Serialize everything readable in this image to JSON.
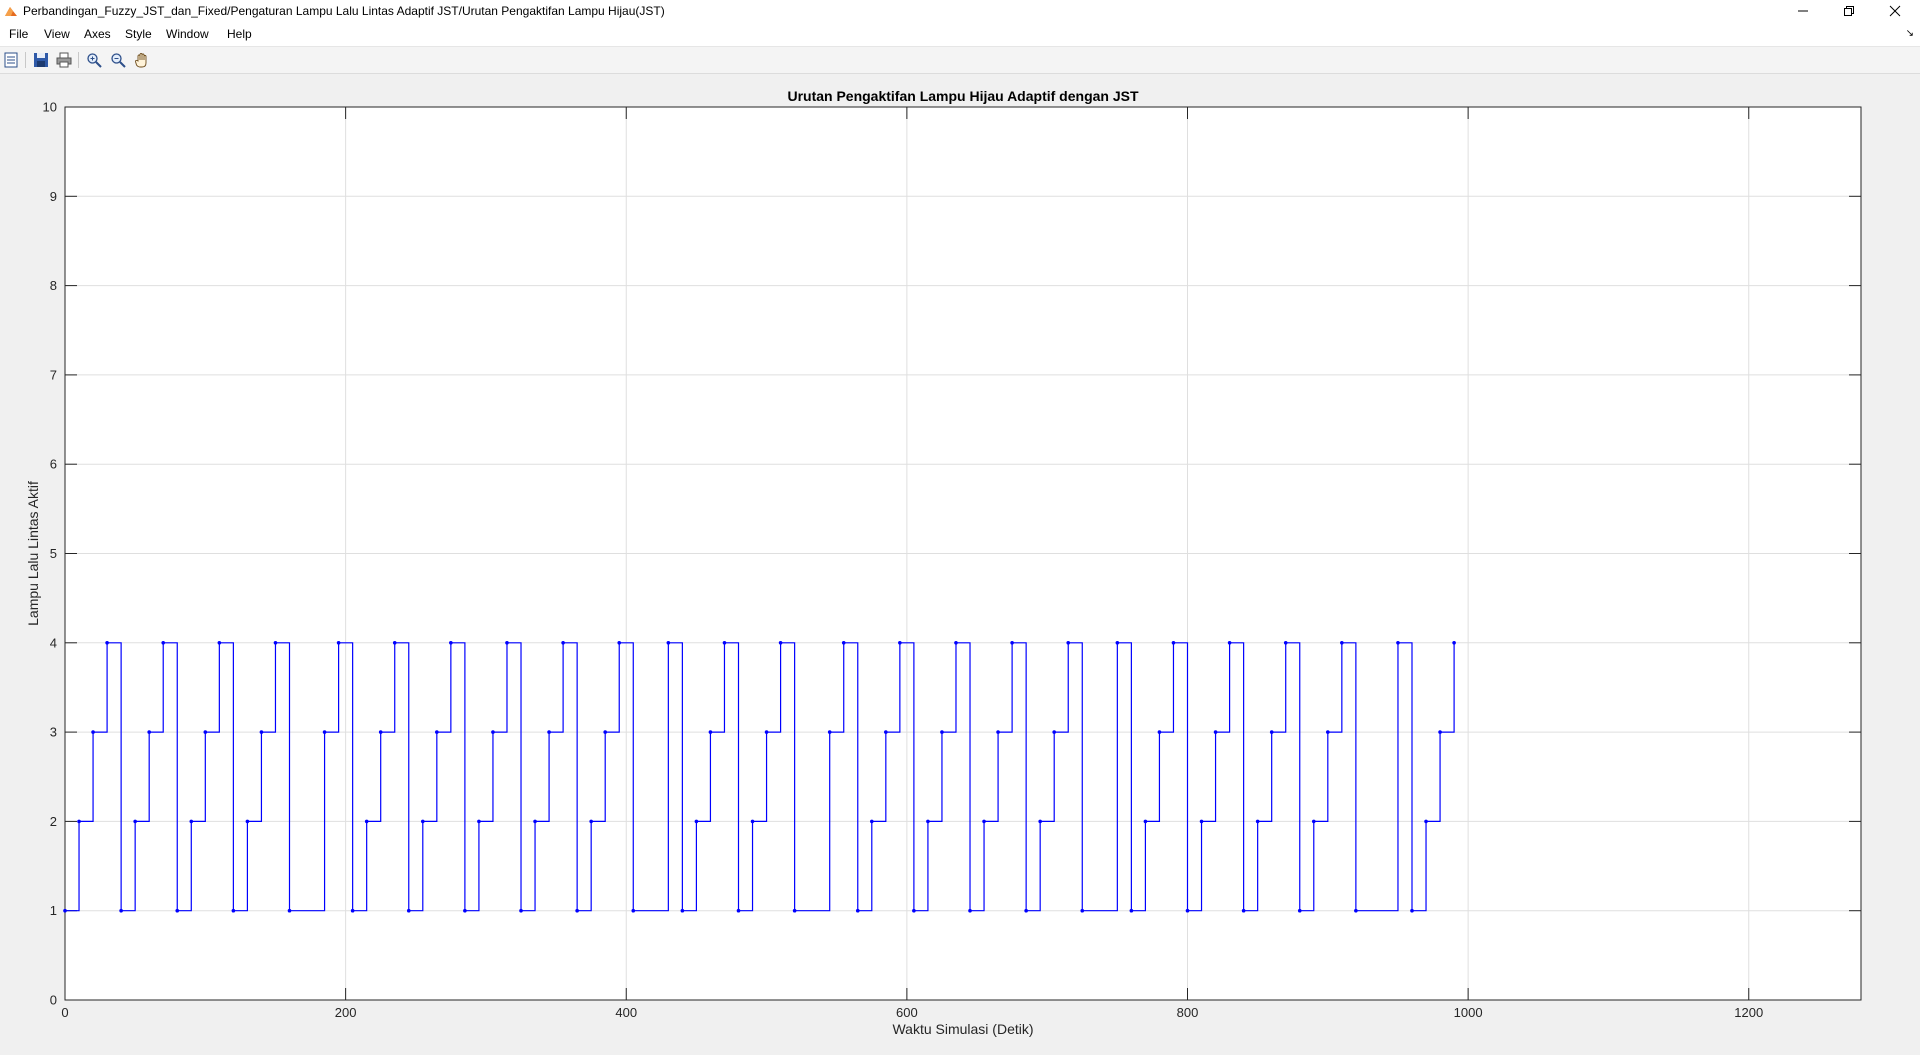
{
  "window": {
    "title": "Perbandingan_Fuzzy_JST_dan_Fixed/Pengaturan Lampu  Lalu Lintas Adaptif JST/Urutan Pengaktifan  Lampu Hijau(JST)",
    "controls": [
      "minimize",
      "restore",
      "close"
    ]
  },
  "menu": {
    "items": [
      "File",
      "View",
      "Axes",
      "Style",
      "Window",
      "Help"
    ]
  },
  "toolbar": {
    "icons": [
      "property-editor-icon",
      "save-icon",
      "print-icon",
      "zoom-in-icon",
      "zoom-out-icon",
      "pan-icon"
    ]
  },
  "chart_data": {
    "type": "line",
    "title": "Urutan Pengaktifan Lampu Hijau Adaptif dengan JST",
    "xlabel": "Waktu Simulasi (Detik)",
    "ylabel": "Lampu Lalu Lintas Aktif",
    "xlim": [
      0,
      1280
    ],
    "ylim": [
      0,
      10
    ],
    "xticks": [
      0,
      200,
      400,
      600,
      800,
      1000,
      1200
    ],
    "yticks": [
      0,
      1,
      2,
      3,
      4,
      5,
      6,
      7,
      8,
      9,
      10
    ],
    "grid": true,
    "line_color": "#0000ff",
    "marker": "dot",
    "step_style": "stairs",
    "series": [
      {
        "x": [
          0,
          10,
          20,
          30,
          40,
          50,
          60,
          70,
          80,
          90,
          100,
          110,
          120,
          130,
          140,
          150,
          160,
          185,
          195,
          205,
          215,
          225,
          235,
          245,
          255,
          265,
          275,
          285,
          295,
          305,
          315,
          325,
          335,
          345,
          355,
          365,
          375,
          385,
          395,
          405,
          430,
          440,
          450,
          460,
          470,
          480,
          490,
          500,
          510,
          520,
          545,
          555,
          565,
          575,
          585,
          595,
          605,
          615,
          625,
          635,
          645,
          655,
          665,
          675,
          685,
          695,
          705,
          715,
          725,
          750,
          760,
          770,
          780,
          790,
          800,
          810,
          820,
          830,
          840,
          850,
          860,
          870,
          880,
          890,
          900,
          910,
          920,
          950,
          960,
          970,
          980,
          990
        ],
        "y": [
          1,
          2,
          3,
          4,
          1,
          2,
          3,
          4,
          1,
          2,
          3,
          4,
          1,
          2,
          3,
          4,
          1,
          3,
          4,
          1,
          2,
          3,
          4,
          1,
          2,
          3,
          4,
          1,
          2,
          3,
          4,
          1,
          2,
          3,
          4,
          1,
          2,
          3,
          4,
          1,
          4,
          1,
          2,
          3,
          4,
          1,
          2,
          3,
          4,
          1,
          3,
          4,
          1,
          2,
          3,
          4,
          1,
          2,
          3,
          4,
          1,
          2,
          3,
          4,
          1,
          2,
          3,
          4,
          1,
          4,
          1,
          2,
          3,
          4,
          1,
          2,
          3,
          4,
          1,
          2,
          3,
          4,
          1,
          2,
          3,
          4,
          1,
          4,
          1,
          2,
          3,
          4
        ]
      }
    ]
  }
}
